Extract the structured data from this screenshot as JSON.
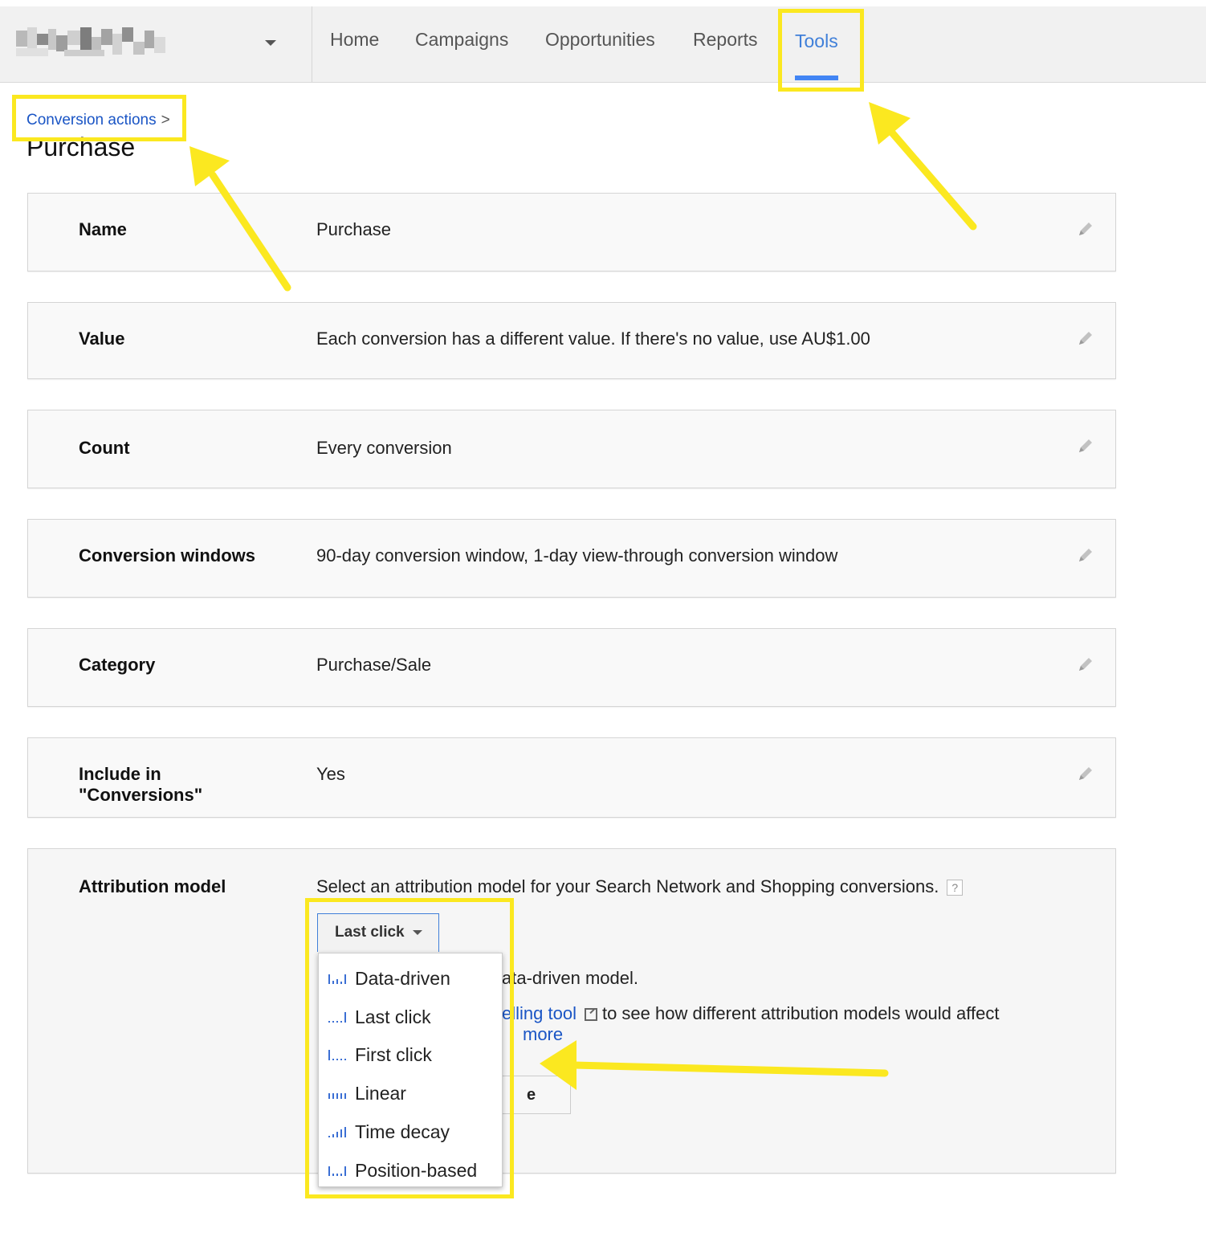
{
  "nav": {
    "items": [
      {
        "label": "Home",
        "active": false
      },
      {
        "label": "Campaigns",
        "active": false
      },
      {
        "label": "Opportunities",
        "active": false
      },
      {
        "label": "Reports",
        "active": false
      },
      {
        "label": "Tools",
        "active": true
      }
    ]
  },
  "breadcrumb": {
    "link": "Conversion actions",
    "separator": ">"
  },
  "page": {
    "title": "Purchase"
  },
  "rows": {
    "name": {
      "label": "Name",
      "value": "Purchase"
    },
    "value": {
      "label": "Value",
      "value": "Each conversion has a different value. If there's no value, use AU$1.00"
    },
    "count": {
      "label": "Count",
      "value": "Every conversion"
    },
    "windows": {
      "label": "Conversion windows",
      "value": "90-day conversion window, 1-day view-through conversion window"
    },
    "category": {
      "label": "Category",
      "value": "Purchase/Sale"
    },
    "include": {
      "label_line1": "Include in",
      "label_line2": "\"Conversions\"",
      "value": "Yes"
    },
    "attribution": {
      "label": "Attribution model",
      "description": "Select an attribution model for your Search Network and Shopping conversions.",
      "help": "?",
      "selected": "Last click",
      "partial_text_1": "ata-driven model.",
      "partial_link_2": "elling tool",
      "partial_text_2": "to see how different attribution models would affect",
      "partial_link_3": "more",
      "partial_button": "e"
    }
  },
  "menu": {
    "items": [
      {
        "label": "Data-driven",
        "icon": "data-driven-bars-icon"
      },
      {
        "label": "Last click",
        "icon": "last-click-bars-icon"
      },
      {
        "label": "First click",
        "icon": "first-click-bars-icon"
      },
      {
        "label": "Linear",
        "icon": "linear-bars-icon"
      },
      {
        "label": "Time decay",
        "icon": "time-decay-bars-icon"
      },
      {
        "label": "Position-based",
        "icon": "position-based-bars-icon"
      }
    ]
  },
  "colors": {
    "accent": "#4285f4",
    "link": "#1a55c5",
    "highlight": "#fbe820"
  }
}
